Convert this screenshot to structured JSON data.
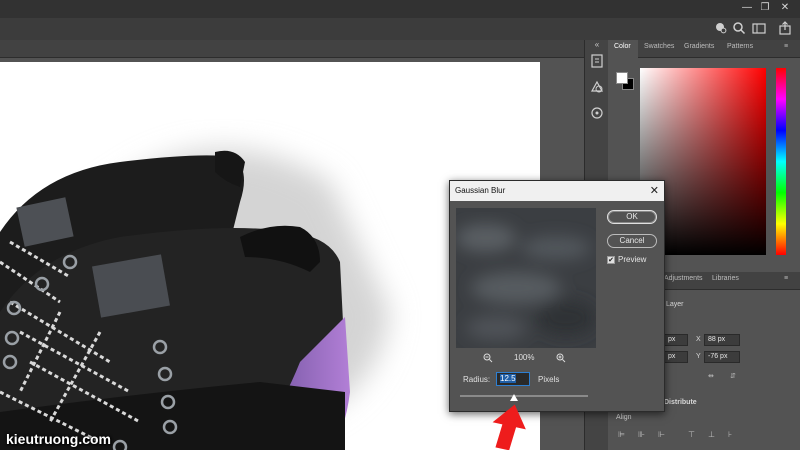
{
  "window": {
    "minimize": "—",
    "restore": "❐",
    "close": "✕"
  },
  "optionsbar": {
    "icons": [
      "search-icon",
      "workspace-icon",
      "share-icon"
    ]
  },
  "panels": {
    "color_tabs": [
      "Color",
      "Swatches",
      "Gradients",
      "Patterns"
    ],
    "props_tabs": [
      "Adjustments",
      "Libraries"
    ],
    "props": {
      "layer_label": "Layer",
      "w_value": "px",
      "h_value": "px",
      "x_label": "X",
      "x_value": "88 px",
      "y_label": "Y",
      "y_value": "-76 px",
      "distribute_label": "Distribute",
      "align_label": "Align"
    }
  },
  "dialog": {
    "title": "Gaussian Blur",
    "ok": "OK",
    "cancel": "Cancel",
    "preview_label": "Preview",
    "preview_checked": "✔",
    "zoom_level": "100%",
    "radius_label": "Radius:",
    "radius_value": "12.5",
    "units": "Pixels"
  },
  "watermark": "kieutruong.com",
  "colors": {
    "accent_red": "#ee1c1c",
    "ui_dark": "#535353"
  }
}
